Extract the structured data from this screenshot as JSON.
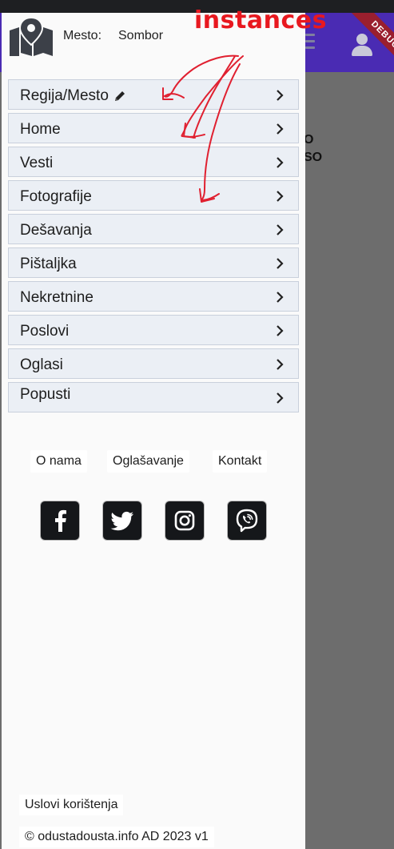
{
  "app": {
    "debug_label": "DEBUG",
    "partial_text_1": "O",
    "partial_text_2": "SO"
  },
  "drawer": {
    "mesto_label": "Mesto:",
    "mesto_value": "Sombor",
    "menu_items": [
      {
        "label": "Regija/Mesto",
        "has_pencil": true
      },
      {
        "label": "Home"
      },
      {
        "label": "Vesti"
      },
      {
        "label": "Fotografije"
      },
      {
        "label": "Dešavanja"
      },
      {
        "label": "Pištaljka"
      },
      {
        "label": "Nekretnine"
      },
      {
        "label": "Poslovi"
      },
      {
        "label": "Oglasi"
      },
      {
        "label": "Popusti"
      }
    ],
    "footer_links": [
      "O nama",
      "Oglašavanje",
      "Kontakt"
    ],
    "social": [
      "facebook-icon",
      "twitter-icon",
      "instagram-icon",
      "viber-icon"
    ],
    "terms_link": "Uslovi korištenja",
    "copyright": "© odustadousta.info AD 2023 v1"
  },
  "annotation": {
    "text": "instances",
    "color": "#e8181f"
  },
  "colors": {
    "header": "#4a2bb3",
    "menu_bg": "#ebeff5",
    "debug": "#9a1f2e"
  }
}
